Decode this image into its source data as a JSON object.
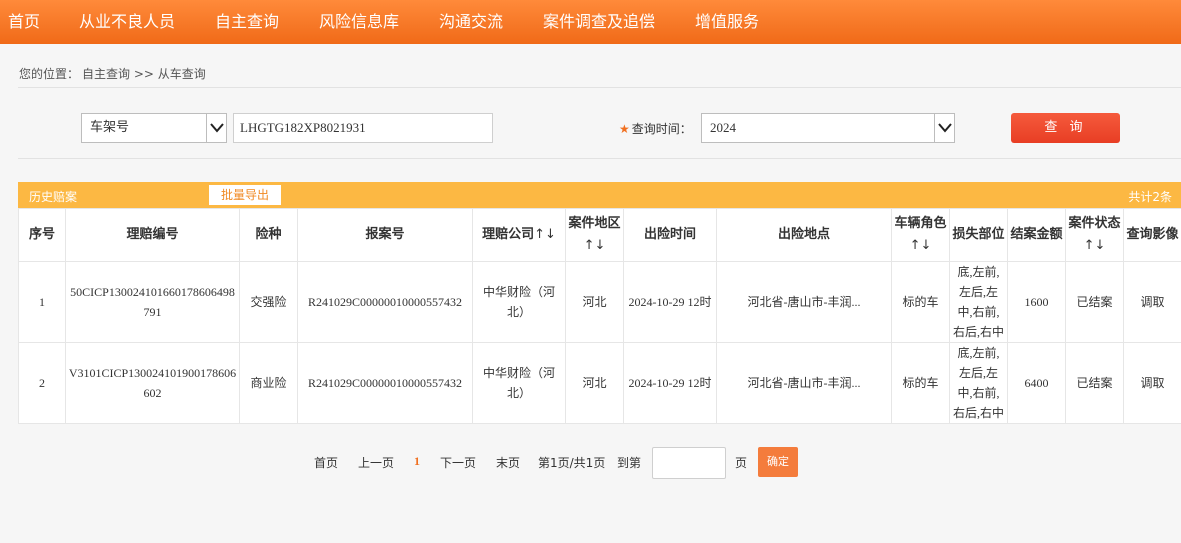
{
  "nav": {
    "items": [
      "首页",
      "从业不良人员",
      "自主查询",
      "风险信息库",
      "沟通交流",
      "案件调查及追偿",
      "增值服务"
    ]
  },
  "breadcrumb": {
    "prefix": "您的位置：",
    "path": "自主查询 >> 从车查询"
  },
  "search": {
    "type_selected": "车架号",
    "vin_value": "LHGTG182XP8021931",
    "time_label": "查询时间：",
    "time_selected": "2024",
    "query_button": "查 询"
  },
  "history": {
    "title": "历史赔案",
    "export_button": "批量导出",
    "total": "共计2条"
  },
  "table": {
    "headers": {
      "seq": "序号",
      "claim_no": "理赔编号",
      "insurance_type": "险种",
      "report_no": "报案号",
      "company": "理赔公司",
      "region": "案件地区",
      "time": "出险时间",
      "location": "出险地点",
      "vehicle_role": "车辆角色",
      "damage": "损失部位",
      "amount": "结案金额",
      "status": "案件状态",
      "image": "查询影像"
    },
    "sort_mark": "↑↓",
    "rows": [
      {
        "seq": "1",
        "claim_no": "50CICP130024101660178606498791",
        "insurance_type": "交强险",
        "report_no": "R241029C00000010000557432",
        "company": "中华财险（河北）",
        "region": "河北",
        "time": "2024-10-29 12时",
        "location": "河北省-唐山市-丰润...",
        "vehicle_role": "标的车",
        "damage": "底,左前,左后,左中,右前,右后,右中",
        "amount": "1600",
        "status": "已结案",
        "image": "调取"
      },
      {
        "seq": "2",
        "claim_no": "V3101CICP130024101900178606602",
        "insurance_type": "商业险",
        "report_no": "R241029C00000010000557432",
        "company": "中华财险（河北）",
        "region": "河北",
        "time": "2024-10-29 12时",
        "location": "河北省-唐山市-丰润...",
        "vehicle_role": "标的车",
        "damage": "底,左前,左后,左中,右前,右后,右中",
        "amount": "6400",
        "status": "已结案",
        "image": "调取"
      }
    ]
  },
  "pagination": {
    "first": "首页",
    "prev": "上一页",
    "current": "1",
    "next": "下一页",
    "last": "末页",
    "info": "第1页/共1页",
    "goto_label": "到第",
    "page_unit": "页",
    "confirm": "确定"
  },
  "colors": {
    "nav_bg": "#f06a18",
    "history_bar": "#fcb843",
    "query_button": "#e83e24",
    "accent": "#f07020"
  }
}
